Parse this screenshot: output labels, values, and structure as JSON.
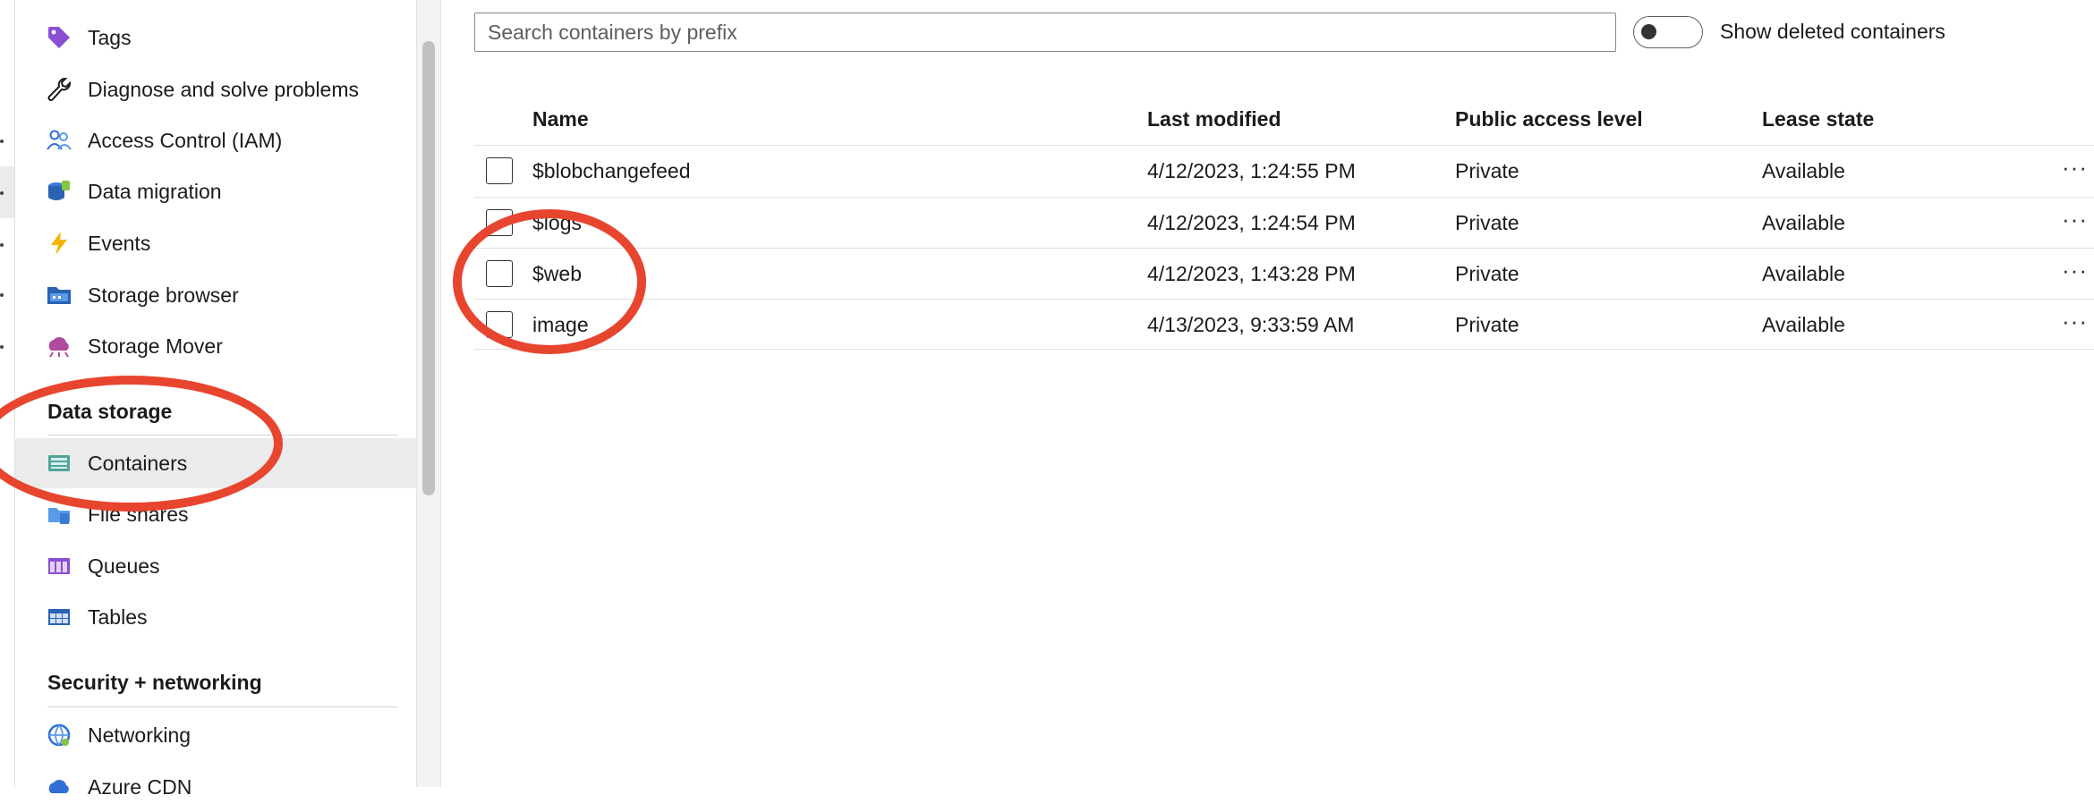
{
  "sidebar": {
    "items_top": [
      {
        "label": "Tags",
        "icon": "tag-icon"
      },
      {
        "label": "Diagnose and solve problems",
        "icon": "wrench-icon"
      },
      {
        "label": "Access Control (IAM)",
        "icon": "people-icon"
      },
      {
        "label": "Data migration",
        "icon": "data-migration-icon"
      },
      {
        "label": "Events",
        "icon": "lightning-icon"
      },
      {
        "label": "Storage browser",
        "icon": "storage-browser-icon"
      },
      {
        "label": "Storage Mover",
        "icon": "storage-mover-icon"
      }
    ],
    "section_data_storage": "Data storage",
    "data_storage_items": [
      {
        "label": "Containers",
        "icon": "containers-icon",
        "selected": true
      },
      {
        "label": "File shares",
        "icon": "file-shares-icon"
      },
      {
        "label": "Queues",
        "icon": "queues-icon"
      },
      {
        "label": "Tables",
        "icon": "tables-icon"
      }
    ],
    "section_security": "Security + networking",
    "security_items": [
      {
        "label": "Networking",
        "icon": "networking-icon"
      },
      {
        "label": "Azure CDN",
        "icon": "cdn-icon"
      }
    ]
  },
  "search": {
    "placeholder": "Search containers by prefix",
    "value": ""
  },
  "toggle": {
    "label": "Show deleted containers",
    "on": false
  },
  "table": {
    "columns": [
      "Name",
      "Last modified",
      "Public access level",
      "Lease state"
    ],
    "rows": [
      {
        "name": "$blobchangefeed",
        "modified": "4/12/2023, 1:24:55 PM",
        "access": "Private",
        "lease": "Available"
      },
      {
        "name": "$logs",
        "modified": "4/12/2023, 1:24:54 PM",
        "access": "Private",
        "lease": "Available"
      },
      {
        "name": "$web",
        "modified": "4/12/2023, 1:43:28 PM",
        "access": "Private",
        "lease": "Available"
      },
      {
        "name": "image",
        "modified": "4/13/2023, 9:33:59 AM",
        "access": "Private",
        "lease": "Available"
      }
    ],
    "more_glyph": "···"
  },
  "colors": {
    "annotation": "#e8452f",
    "selected_bg": "#ebebeb",
    "accent": "#0078d4"
  }
}
